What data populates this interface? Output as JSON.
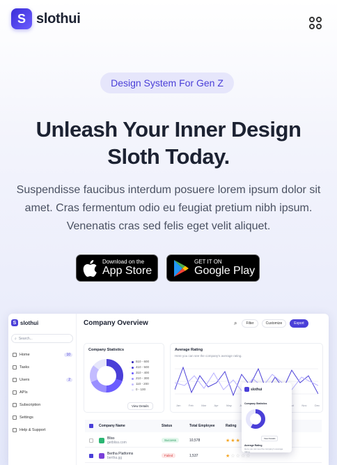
{
  "brand": {
    "name": "slothui",
    "mark": "S"
  },
  "hero": {
    "badge": "Design System For Gen Z",
    "title_line1": "Unleash Your Inner Design",
    "title_line2": "Sloth Today.",
    "subtitle": "Suspendisse faucibus interdum posuere lorem ipsum dolor sit amet. Cras fermentum odio eu feugiat pretium nibh ipsum. Venenatis cras sed felis eget velit aliquet."
  },
  "stores": {
    "apple": {
      "small": "Download on the",
      "big": "App Store",
      "icon": "apple-icon"
    },
    "google": {
      "small": "GET IT ON",
      "big": "Google Play",
      "icon": "google-play-icon"
    }
  },
  "colors": {
    "primary": "#4a3fd8",
    "text": "#1c2232",
    "muted": "#4a5162"
  },
  "dashboard": {
    "brand": "slothui",
    "search_placeholder": "Search...",
    "nav": [
      {
        "label": "Home",
        "count": "10"
      },
      {
        "label": "Tasks",
        "count": ""
      },
      {
        "label": "Users",
        "count": "2"
      },
      {
        "label": "APIs",
        "count": ""
      },
      {
        "label": "Subscription",
        "count": ""
      },
      {
        "label": "Settings",
        "count": ""
      },
      {
        "label": "Help & Support",
        "count": ""
      }
    ],
    "title": "Company Overview",
    "filter": "Filter",
    "customize": "Customize",
    "export": "Export",
    "stats_card": {
      "title": "Company Statistics",
      "view": "View Details",
      "legend": [
        "510 - 600",
        "410 - 500",
        "310 - 400",
        "210 - 300",
        "110 - 200",
        "0 - 100"
      ]
    },
    "rating_card": {
      "title": "Average Rating",
      "subtitle": "Here you can see the company's average rating.",
      "months": [
        "Jan",
        "Feb",
        "Mar",
        "Apr",
        "May",
        "Jun",
        "Jul",
        "Aug",
        "Sep",
        "Oct",
        "Nov",
        "Dec"
      ]
    },
    "table": {
      "headers": [
        "Company Name",
        "Status",
        "Total Employee",
        "Rating"
      ],
      "rows": [
        {
          "name": "Bliss",
          "domain": "getbliss.com",
          "status": "Success",
          "employees": "10,578",
          "rating": 3
        },
        {
          "name": "Bertha Platforms",
          "domain": "bertha.gg",
          "status": "Failed",
          "employees": "1,537",
          "rating": 1
        }
      ]
    },
    "popup": {
      "brand": "slothui",
      "stats_title": "Company Statistics",
      "view": "View Details",
      "rating_title": "Average Rating",
      "rating_sub": "Here you can see the company's average rating."
    }
  }
}
